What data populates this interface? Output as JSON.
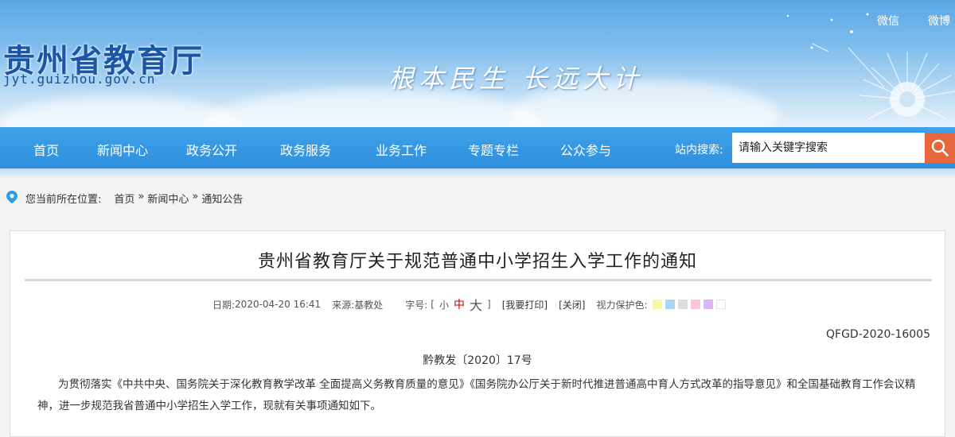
{
  "header": {
    "site_name": "贵州省教育厅",
    "site_domain": "jyt.guizhou.gov.cn",
    "slogan": "根本民生 长远大计",
    "top_links": [
      "微信",
      "微博"
    ]
  },
  "nav": {
    "items": [
      "首页",
      "新闻中心",
      "政务公开",
      "政务服务",
      "业务工作",
      "专题专栏",
      "公众参与"
    ],
    "search_label": "站内搜索:",
    "search_placeholder": "请输入关键字搜索"
  },
  "breadcrumb": {
    "prefix": "您当前所在位置:",
    "items": [
      "首页",
      "新闻中心",
      "通知公告"
    ],
    "separator": "»"
  },
  "article": {
    "title": "贵州省教育厅关于规范普通中小学招生入学工作的通知",
    "date_label": "日期:",
    "date": "2020-04-20 16:41",
    "source_label": "来源:",
    "source": "基教处",
    "font_size_label": "字号:",
    "font_size_open": "[",
    "font_size_close": "]",
    "font_sizes": [
      "小",
      "中",
      "大"
    ],
    "print": "[我要打印]",
    "close": "[关闭]",
    "eye_care_label": "视力保护色:",
    "eye_care_colors": [
      "#faf3a8",
      "#a8d8f0",
      "#dcdcdc",
      "#f7c9d4",
      "#d9b8f0",
      "#ffffff"
    ],
    "doc_code": "QFGD-2020-16005",
    "doc_number": "黔教发〔2020〕17号",
    "body": "为贯彻落实《中共中央、国务院关于深化教育教学改革 全面提高义务教育质量的意见》《国务院办公厅关于新时代推进普通高中育人方式改革的指导意见》和全国基础教育工作会议精神，进一步规范我省普通中小学招生入学工作，现就有关事项通知如下。"
  },
  "colors": {
    "nav_bg": "#3399e6",
    "search_button": "#e8663c",
    "title_text": "#222222",
    "active_font_size": "#cc0000"
  }
}
